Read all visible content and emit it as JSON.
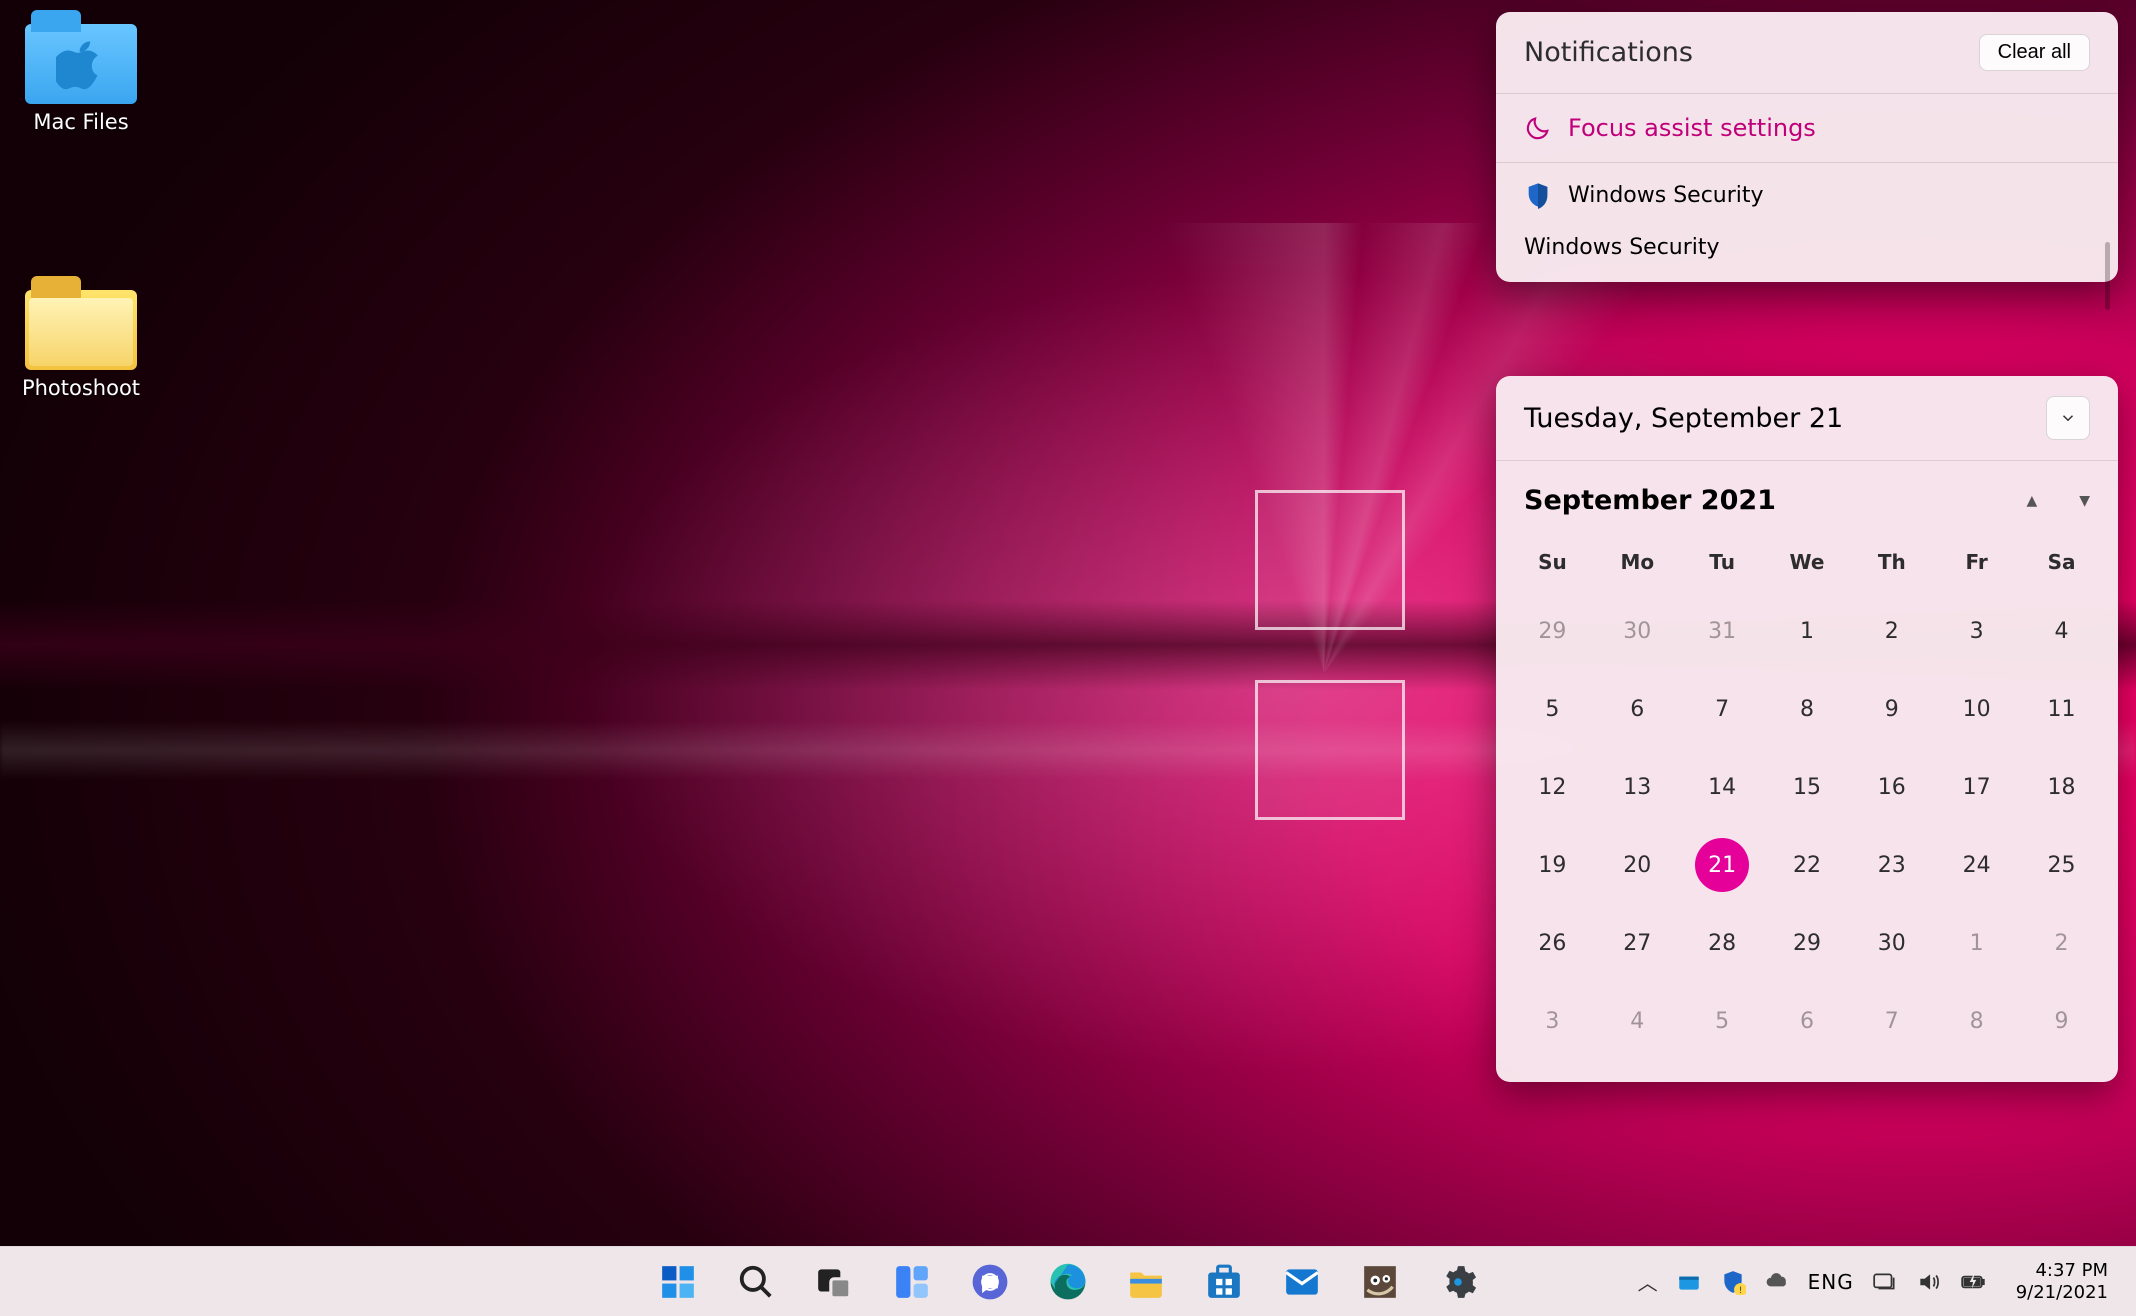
{
  "desktop": {
    "icons": [
      {
        "label": "Mac Files",
        "kind": "folder-blue"
      },
      {
        "label": "Photoshoot",
        "kind": "folder-yellow"
      }
    ]
  },
  "notifications": {
    "title": "Notifications",
    "clear_label": "Clear all",
    "focus_assist_label": "Focus assist settings",
    "items": [
      {
        "app": "Windows Security",
        "title": "Windows Security"
      }
    ]
  },
  "calendar": {
    "today_label": "Tuesday, September 21",
    "month_label": "September 2021",
    "weekdays": [
      "Su",
      "Mo",
      "Tu",
      "We",
      "Th",
      "Fr",
      "Sa"
    ],
    "today": 21,
    "weeks": [
      [
        {
          "d": 29,
          "out": true
        },
        {
          "d": 30,
          "out": true
        },
        {
          "d": 31,
          "out": true
        },
        {
          "d": 1
        },
        {
          "d": 2
        },
        {
          "d": 3
        },
        {
          "d": 4
        }
      ],
      [
        {
          "d": 5
        },
        {
          "d": 6
        },
        {
          "d": 7
        },
        {
          "d": 8
        },
        {
          "d": 9
        },
        {
          "d": 10
        },
        {
          "d": 11
        }
      ],
      [
        {
          "d": 12
        },
        {
          "d": 13
        },
        {
          "d": 14
        },
        {
          "d": 15
        },
        {
          "d": 16
        },
        {
          "d": 17
        },
        {
          "d": 18
        }
      ],
      [
        {
          "d": 19
        },
        {
          "d": 20
        },
        {
          "d": 21
        },
        {
          "d": 22
        },
        {
          "d": 23
        },
        {
          "d": 24
        },
        {
          "d": 25
        }
      ],
      [
        {
          "d": 26
        },
        {
          "d": 27
        },
        {
          "d": 28
        },
        {
          "d": 29
        },
        {
          "d": 30
        },
        {
          "d": 1,
          "out": true
        },
        {
          "d": 2,
          "out": true
        }
      ],
      [
        {
          "d": 3,
          "out": true
        },
        {
          "d": 4,
          "out": true
        },
        {
          "d": 5,
          "out": true
        },
        {
          "d": 6,
          "out": true
        },
        {
          "d": 7,
          "out": true
        },
        {
          "d": 8,
          "out": true
        },
        {
          "d": 9,
          "out": true
        }
      ]
    ]
  },
  "taskbar": {
    "apps": [
      "start",
      "search",
      "task-view",
      "widgets",
      "chat",
      "edge",
      "file-explorer",
      "microsoft-store",
      "mail",
      "gimp",
      "settings"
    ],
    "systray": {
      "overflow": "▲",
      "language": "ENG",
      "time": "4:37 PM",
      "date": "9/21/2021"
    }
  },
  "accent_color": "#c0007a"
}
